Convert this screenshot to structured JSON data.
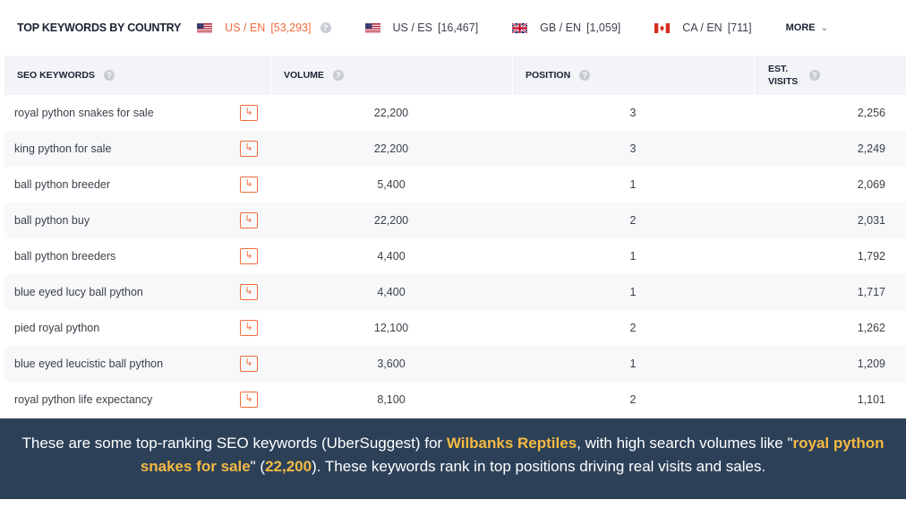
{
  "header": {
    "title": "TOP KEYWORDS BY COUNTRY",
    "tabs": [
      {
        "label": "US / EN",
        "count": "[53,293]",
        "flag": "us-flag",
        "active": true
      },
      {
        "label": "US / ES",
        "count": "[16,467]",
        "flag": "us-flag",
        "active": false
      },
      {
        "label": "GB / EN",
        "count": "[1,059]",
        "flag": "gb-flag",
        "active": false
      },
      {
        "label": "CA / EN",
        "count": "[711]",
        "flag": "ca-flag",
        "active": false
      }
    ],
    "more_label": "MORE",
    "help_glyph": "?"
  },
  "table": {
    "columns": {
      "keywords": "SEO KEYWORDS",
      "volume": "VOLUME",
      "position": "POSITION",
      "est_visits": "EST. VISITS"
    },
    "rows": [
      {
        "keyword": "royal python snakes for sale",
        "volume": "22,200",
        "position": "3",
        "visits": "2,256"
      },
      {
        "keyword": "king python for sale",
        "volume": "22,200",
        "position": "3",
        "visits": "2,249"
      },
      {
        "keyword": "ball python breeder",
        "volume": "5,400",
        "position": "1",
        "visits": "2,069"
      },
      {
        "keyword": "ball python buy",
        "volume": "22,200",
        "position": "2",
        "visits": "2,031"
      },
      {
        "keyword": "ball python breeders",
        "volume": "4,400",
        "position": "1",
        "visits": "1,792"
      },
      {
        "keyword": "blue eyed lucy ball python",
        "volume": "4,400",
        "position": "1",
        "visits": "1,717"
      },
      {
        "keyword": "pied royal python",
        "volume": "12,100",
        "position": "2",
        "visits": "1,262"
      },
      {
        "keyword": "blue eyed leucistic ball python",
        "volume": "3,600",
        "position": "1",
        "visits": "1,209"
      },
      {
        "keyword": "royal python life expectancy",
        "volume": "8,100",
        "position": "2",
        "visits": "1,101"
      }
    ]
  },
  "caption": {
    "part1": "These are some top-ranking SEO keywords (UberSuggest) for ",
    "brand": "Wilbanks Reptiles",
    "part2": ", with high search volumes like \"",
    "keyword": "royal python snakes for sale",
    "part3": "\" (",
    "volume": "22,200",
    "part4": "). These keywords rank in top positions driving real visits and sales."
  },
  "colors": {
    "accent": "#f26b3a",
    "caption_bg": "#2c4158",
    "highlight": "#f5b942"
  }
}
